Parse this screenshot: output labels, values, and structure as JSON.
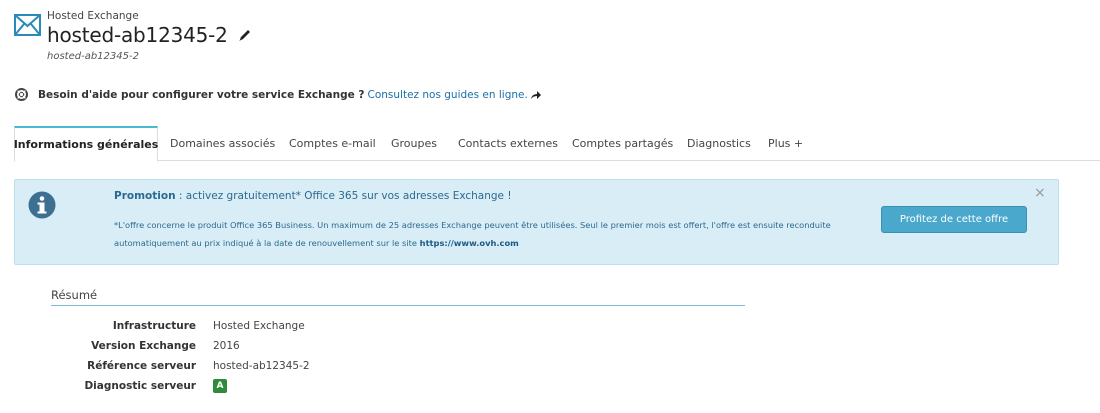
{
  "header": {
    "service_type": "Hosted Exchange",
    "title": "hosted-ab12345-2",
    "subtitle": "hosted-ab12345-2",
    "icons": {
      "service": "mail-icon",
      "edit": "pencil-icon"
    }
  },
  "help": {
    "text": "Besoin d'aide pour configurer votre service Exchange ?",
    "link_text": "Consultez nos guides en ligne.",
    "icons": {
      "help": "lifebuoy-icon",
      "link": "arrow-right-icon"
    }
  },
  "tabs": [
    {
      "label": "Informations générales",
      "active": true
    },
    {
      "label": "Domaines associés",
      "active": false
    },
    {
      "label": "Comptes e-mail",
      "active": false
    },
    {
      "label": "Groupes",
      "active": false
    },
    {
      "label": "Contacts externes",
      "active": false
    },
    {
      "label": "Comptes partagés",
      "active": false
    },
    {
      "label": "Diagnostics",
      "active": false
    },
    {
      "label": "Plus +",
      "active": false
    }
  ],
  "promo": {
    "title_strong": "Promotion",
    "title_rest": " : activez gratuitement* Office 365 sur vos adresses Exchange !",
    "body": "*L'offre concerne le produit Office 365 Business. Un maximum de 25 adresses Exchange peuvent être utilisées. Seul le premier mois est offert, l'offre est ensuite reconduite automatiquement au prix indiqué à la date de renouvellement sur le site ",
    "link": "https://www.ovh.com",
    "button_label": "Profitez de cette offre",
    "close_label": "×"
  },
  "summary": {
    "title": "Résumé",
    "rows": [
      {
        "label": "Infrastructure",
        "value": "Hosted Exchange"
      },
      {
        "label": "Version Exchange",
        "value": "2016"
      },
      {
        "label": "Référence serveur",
        "value": "hosted-ab12345-2"
      },
      {
        "label": "Diagnostic serveur",
        "value": "A"
      }
    ]
  },
  "colors": {
    "accent": "#4bb8d0",
    "link": "#1a6fa8",
    "promo_bg": "#d9edf7",
    "button": "#4aa8cc",
    "badge": "#2e8b3a"
  }
}
